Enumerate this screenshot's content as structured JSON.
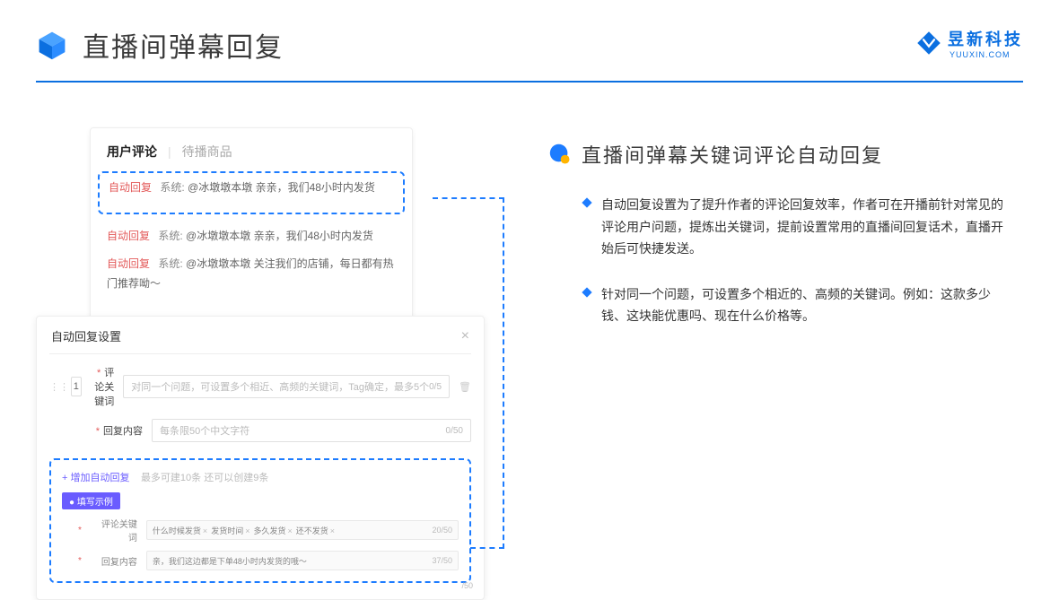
{
  "header": {
    "title": "直播间弹幕回复",
    "brand_text": "昱新科技",
    "brand_sub": "YUUXIN.COM"
  },
  "comment_card": {
    "tab_active": "用户评论",
    "tab_inactive": "待播商品",
    "highlight": {
      "tag": "自动回复",
      "sys": "系统:",
      "mention": "@冰墩墩本墩",
      "text": "亲亲，我们48小时内发货"
    },
    "rows": [
      {
        "tag": "自动回复",
        "sys": "系统:",
        "mention": "@冰墩墩本墩",
        "text": "亲亲，我们48小时内发货"
      },
      {
        "tag": "自动回复",
        "sys": "系统:",
        "mention": "@冰墩墩本墩",
        "text": "关注我们的店铺，每日都有热门推荐呦～"
      }
    ]
  },
  "settings": {
    "title": "自动回复设置",
    "number": "1",
    "kw_label": "评论关键词",
    "kw_placeholder": "对同一个问题，可设置多个相近、高频的关键词，Tag确定，最多5个",
    "kw_count": "0/5",
    "reply_label": "回复内容",
    "reply_placeholder": "每条限50个中文字符",
    "reply_count": "0/50",
    "add_link": "+ 增加自动回复",
    "hint": "最多可建10条 还可以创建9条",
    "badge": "● 填写示例",
    "ex_kw_label": "评论关键词",
    "ex_tags": [
      "什么时候发货",
      "发货时间",
      "多久发货",
      "还不发货"
    ],
    "ex_kw_count": "20/50",
    "ex_reply_label": "回复内容",
    "ex_reply_text": "亲，我们这边都是下单48小时内发货的哦～",
    "ex_reply_count": "37/50",
    "extra_count": "/50"
  },
  "right": {
    "section_title": "直播间弹幕关键词评论自动回复",
    "bullets": [
      "自动回复设置为了提升作者的评论回复效率，作者可在开播前针对常见的评论用户问题，提炼出关键词，提前设置常用的直播间回复话术，直播开始后可快捷发送。",
      "针对同一个问题，可设置多个相近的、高频的关键词。例如：这款多少钱、这块能优惠吗、现在什么价格等。"
    ]
  }
}
